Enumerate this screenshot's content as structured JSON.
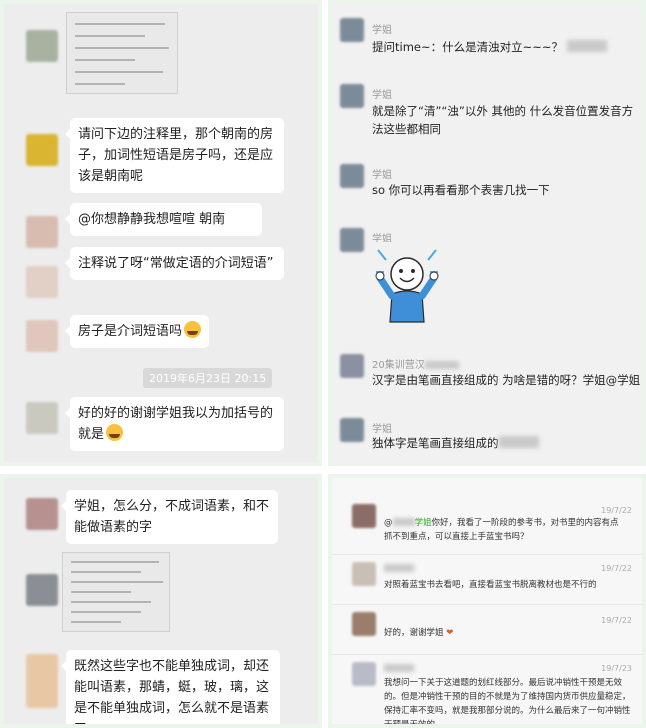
{
  "panel1": {
    "msg1": "请问下边的注释里，那个朝南的房子，加词性短语是房子吗，还是应该是朝南呢",
    "msg2": "@你想静静我想喧喧 朝南",
    "msg3": "注释说了呀“常做定语的介词短语”",
    "msg4": "房子是介词短语吗",
    "timestamp": "2019年6月23日 20:15",
    "msg5": "好的好的谢谢学姐我以为加括号的就是"
  },
  "panel2": {
    "items": [
      {
        "nick": "学姐",
        "text": "提问time~：什么是清浊对立~~~？"
      },
      {
        "nick": "学姐",
        "text": "就是除了“清”“浊”以外 其他的 什么发音位置发音方法这些都相同"
      },
      {
        "nick": "学姐",
        "text": "so 你可以再看看那个表害几找一下"
      },
      {
        "nick": "学姐",
        "text": ""
      },
      {
        "nick": "20集训营汉",
        "text": "汉字是由笔画直接组成的 为啥是错的呀？学姐@学姐"
      },
      {
        "nick": "学姐",
        "text": "独体字是笔画直接组成的"
      }
    ]
  },
  "panel3": {
    "msg1": "学姐，怎么分，不成词语素，和不能做语素的字",
    "msg2": "既然这些字也不能单独成词，却还能叫语素，那蜻，蜓，玻，璃，这是不能单独成词，怎么就不是语素了"
  },
  "panel4": {
    "items": [
      {
        "name": "",
        "date": "19/7/22",
        "prefix": "@",
        "highlight": "学姐",
        "text": "你好，我看了一阶段的参考书，对书里的内容有点抓不到重点，可以直接上手蓝宝书吗？"
      },
      {
        "name": "",
        "date": "19/7/22",
        "text": "对照着蓝宝书去看吧，直接看蓝宝书脱离教材也是不行的"
      },
      {
        "name": "",
        "date": "19/7/22",
        "text": "好的，谢谢学姐"
      },
      {
        "name": "",
        "date": "19/7/23",
        "text": "我想问一下关于这道题的划红线部分。最后说冲销性干预是无效的。但是冲销性干预的目的不就是为了维持国内货币供应量稳定，保持汇率不变吗，就是我那部分说的。为什么最后来了一句冲销性干预是无效的"
      }
    ]
  },
  "colors": {
    "chat_bg": "#ededed",
    "bubble": "#ffffff",
    "highlight_green": "#2aa92a",
    "timestamp_bg": "#d8d8d8"
  }
}
